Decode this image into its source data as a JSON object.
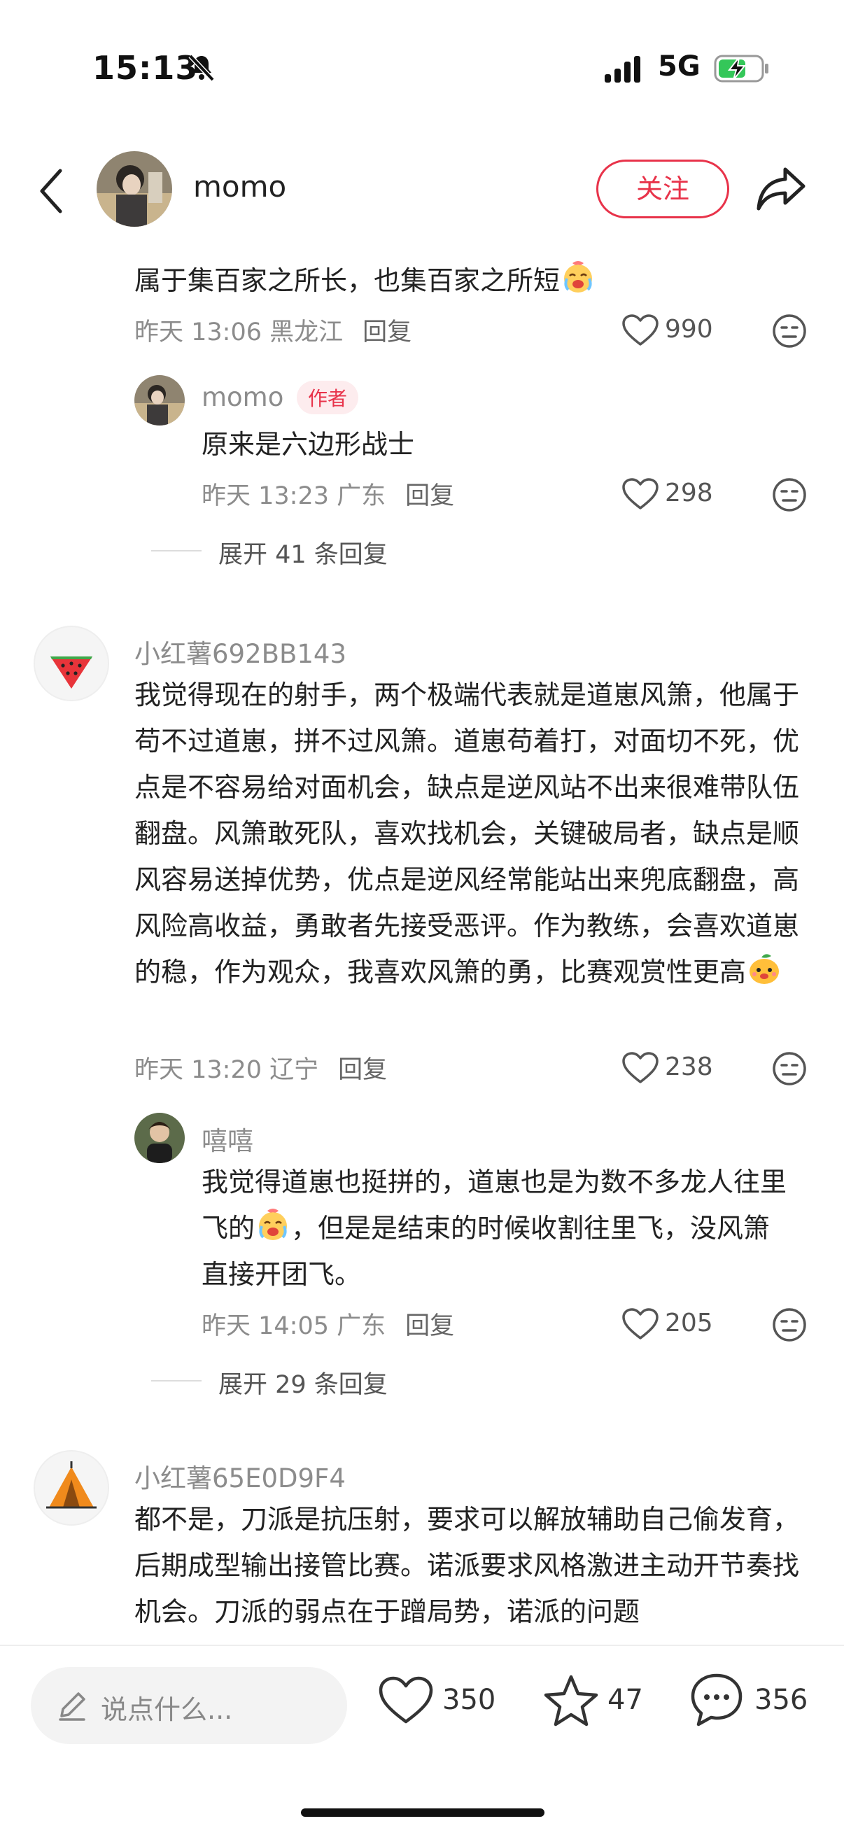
{
  "status_bar": {
    "time": "15:13",
    "network": "5G",
    "mute_icon": "bell-slash-icon",
    "signal_icon": "signal-bars-icon",
    "battery_icon": "battery-charging-icon",
    "battery_color": "#34c759"
  },
  "header": {
    "title": "momo",
    "follow_label": "关注",
    "accent_color": "#e8334a",
    "back_icon": "chevron-left-icon",
    "share_icon": "share-arrow-icon"
  },
  "comments": [
    {
      "text_tail": "属于集百家之所长，也集百家之所短",
      "meta_time": "昨天 13:06 黑龙江",
      "reply_label": "回复",
      "likes": "990",
      "replies": [
        {
          "nick": "momo",
          "tag": "作者",
          "text": "原来是六边形战士",
          "meta_time": "昨天 13:23 广东",
          "reply_label": "回复",
          "likes": "298"
        }
      ],
      "expand_label": "展开 41 条回复"
    },
    {
      "nick": "小红薯692BB143",
      "text": "我觉得现在的射手，两个极端代表就是道崽风箫，他属于苟不过道崽，拼不过风箫。道崽苟着打，对面切不死，优点是不容易给对面机会，缺点是逆风站不出来很难带队伍翻盘。风箫敢死队，喜欢找机会，关键破局者，缺点是顺风容易送掉优势，优点是逆风经常能站出来兜底翻盘，高风险高收益，勇敢者先接受恶评。作为教练，会喜欢道崽的稳，作为观众，我喜欢风箫的勇，比赛观赏性更高",
      "meta_time": "昨天 13:20 辽宁",
      "reply_label": "回复",
      "likes": "238",
      "replies": [
        {
          "nick": "嘻嘻",
          "text_a": "我觉得道崽也挺拼的，道崽也是为数不多龙人往里飞的",
          "text_b": "，但是是结束的时候收割往里飞，没风箫直接开团飞。",
          "meta_time": "昨天 14:05 广东",
          "reply_label": "回复",
          "likes": "205"
        }
      ],
      "expand_label": "展开 29 条回复"
    },
    {
      "nick": "小红薯65E0D9F4",
      "text": "都不是，刀派是抗压射，要求可以解放辅助自己偷发育，后期成型输出接管比赛。诺派要求风格激进主动开节奏找机会。刀派的弱点在于蹭局势，诺派的问题"
    }
  ],
  "bottom_bar": {
    "input_placeholder": "说点什么...",
    "likes": "350",
    "favorites": "47",
    "comments": "356"
  }
}
